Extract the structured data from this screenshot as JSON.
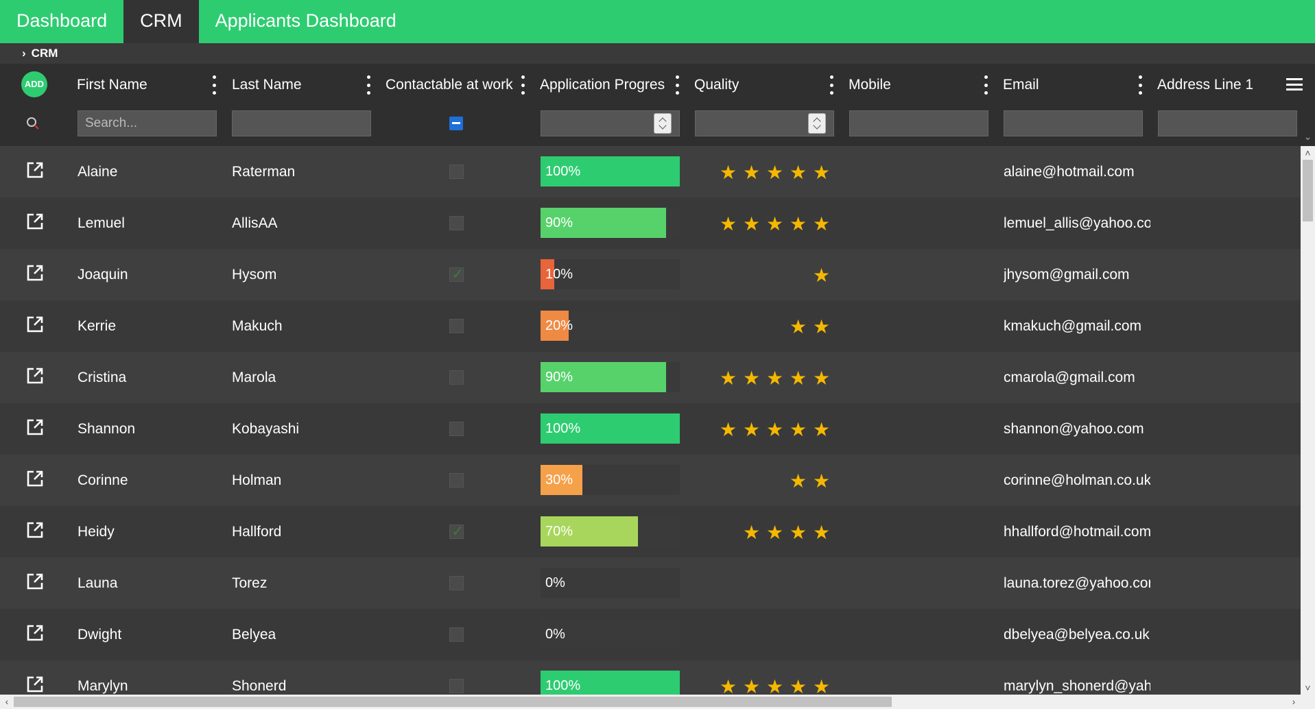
{
  "nav": {
    "tabs": [
      "Dashboard",
      "CRM",
      "Applicants Dashboard"
    ],
    "active": 1
  },
  "breadcrumb": {
    "label": "CRM"
  },
  "grid": {
    "add_label": "ADD",
    "columns": [
      "First Name",
      "Last Name",
      "Contactable at work",
      "Application Progres",
      "Quality",
      "Mobile",
      "Email",
      "Address Line 1"
    ],
    "search_placeholder": "Search...",
    "rows": [
      {
        "first": "Alaine",
        "last": "Raterman",
        "contactable": false,
        "progress": 100,
        "quality": 5,
        "email": "alaine@hotmail.com"
      },
      {
        "first": "Lemuel",
        "last": "AllisAA",
        "contactable": false,
        "progress": 90,
        "quality": 5,
        "email": "lemuel_allis@yahoo.co"
      },
      {
        "first": "Joaquin",
        "last": "Hysom",
        "contactable": true,
        "progress": 10,
        "quality": 1,
        "email": "jhysom@gmail.com"
      },
      {
        "first": "Kerrie",
        "last": "Makuch",
        "contactable": false,
        "progress": 20,
        "quality": 2,
        "email": "kmakuch@gmail.com"
      },
      {
        "first": "Cristina",
        "last": "Marola",
        "contactable": false,
        "progress": 90,
        "quality": 5,
        "email": "cmarola@gmail.com"
      },
      {
        "first": "Shannon",
        "last": "Kobayashi",
        "contactable": false,
        "progress": 100,
        "quality": 5,
        "email": "shannon@yahoo.com"
      },
      {
        "first": "Corinne",
        "last": "Holman",
        "contactable": false,
        "progress": 30,
        "quality": 2,
        "email": "corinne@holman.co.uk"
      },
      {
        "first": "Heidy",
        "last": "Hallford",
        "contactable": true,
        "progress": 70,
        "quality": 4,
        "email": "hhallford@hotmail.com"
      },
      {
        "first": "Launa",
        "last": "Torez",
        "contactable": false,
        "progress": 0,
        "quality": 0,
        "email": "launa.torez@yahoo.com"
      },
      {
        "first": "Dwight",
        "last": "Belyea",
        "contactable": false,
        "progress": 0,
        "quality": 0,
        "email": "dbelyea@belyea.co.uk"
      },
      {
        "first": "Marylyn",
        "last": "Shonerd",
        "contactable": false,
        "progress": 100,
        "quality": 5,
        "email": "marylyn_shonerd@yahoo.com"
      }
    ]
  },
  "colors": {
    "accent": "#2ecc71",
    "star": "#f5b800",
    "progress_100": "#2ecc71",
    "progress_90": "#57d26b",
    "progress_70": "#a8d65c",
    "progress_30": "#f5a14a",
    "progress_20": "#ef8a45",
    "progress_10": "#e8643a"
  },
  "icons": {
    "edit": "open-in-new-icon",
    "search": "search-icon",
    "menu": "hamburger-icon",
    "column_menu": "kebab-icon"
  }
}
